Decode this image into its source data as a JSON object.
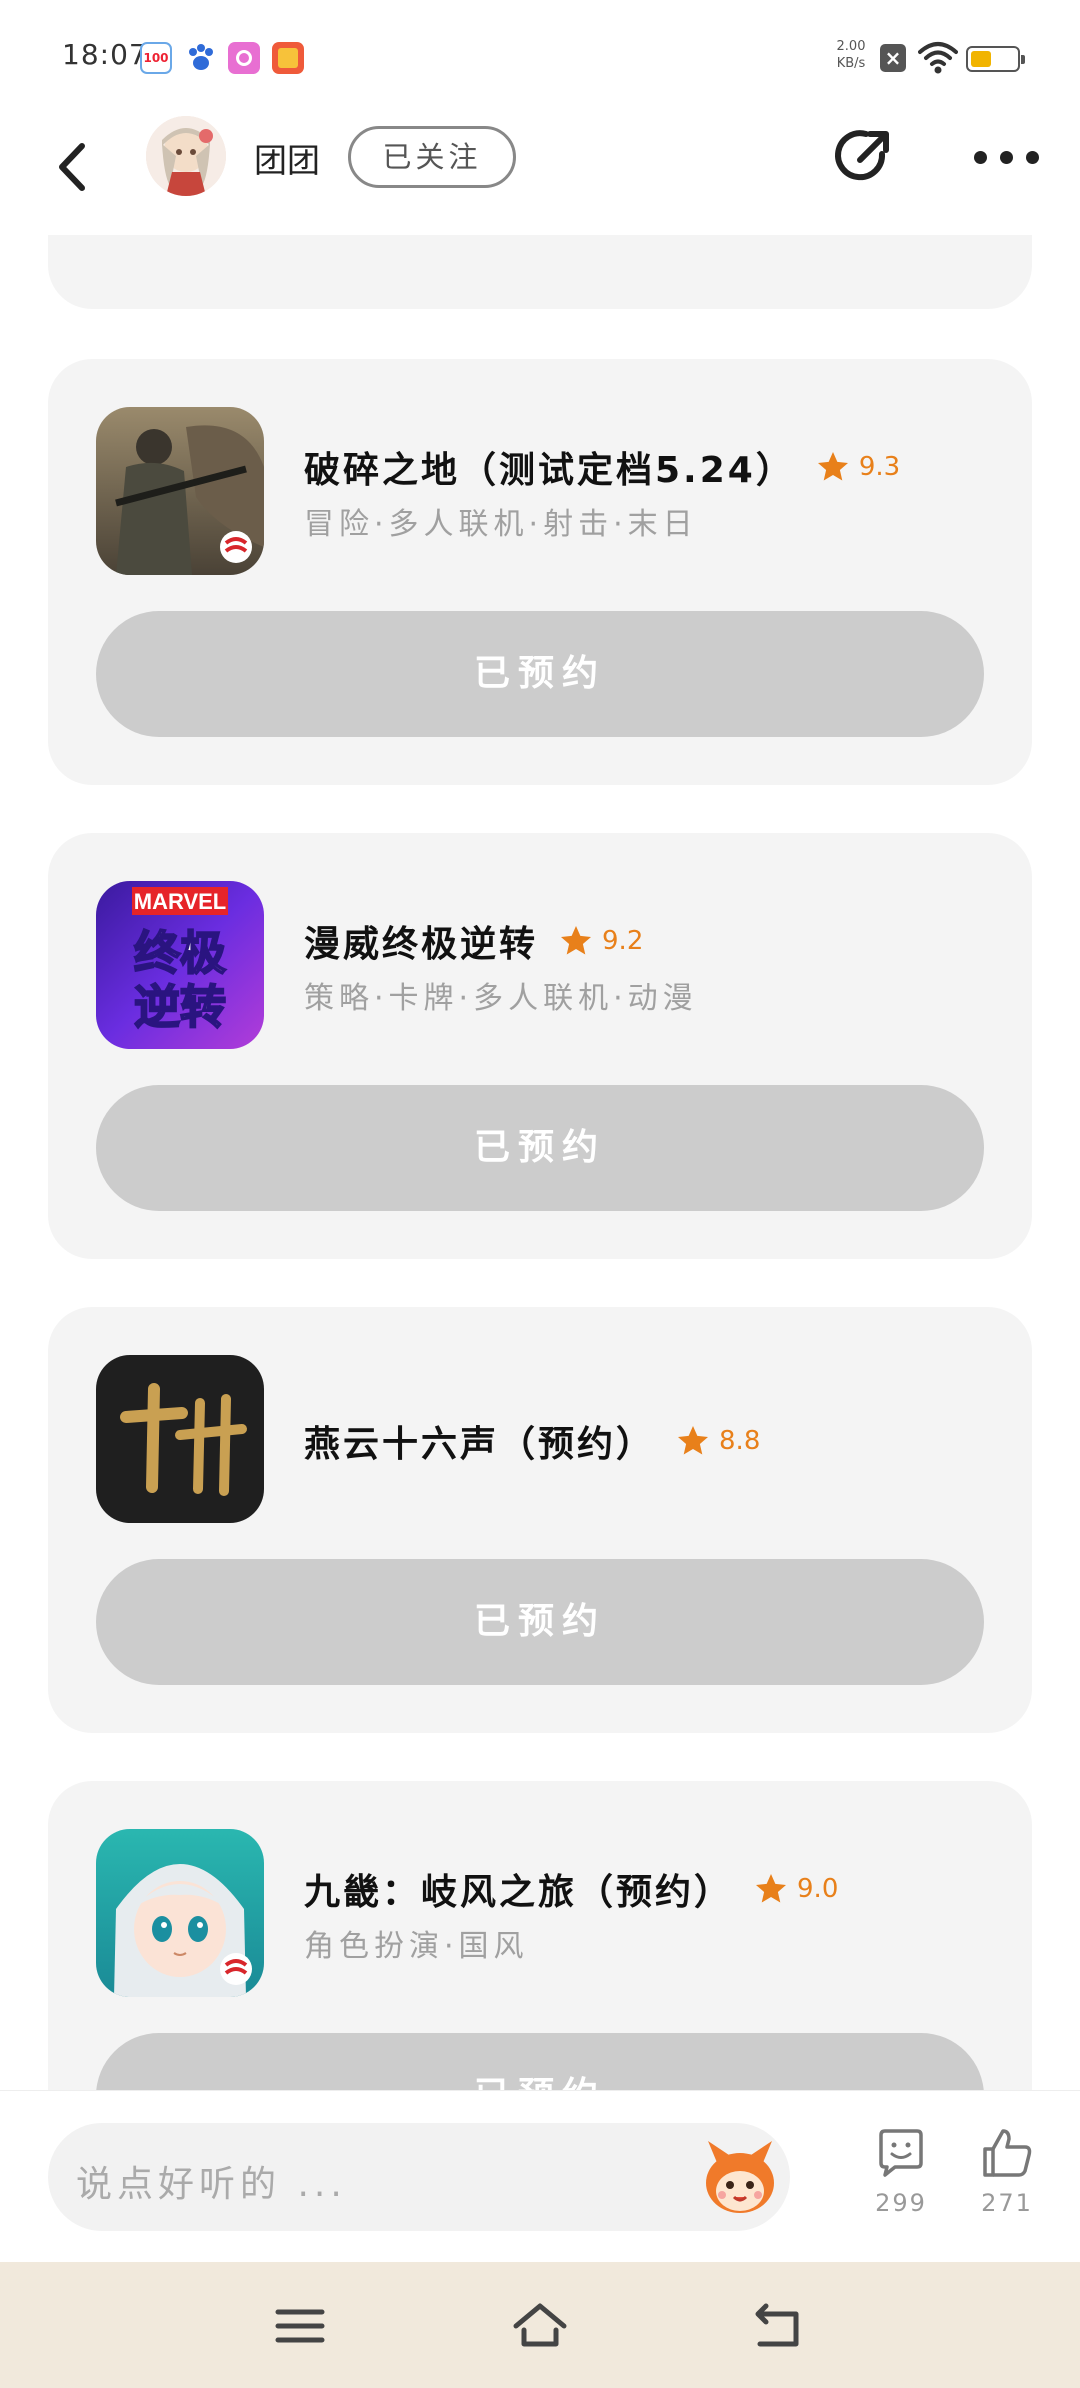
{
  "status_bar": {
    "time": "18:07",
    "net_speed_value": "2.00",
    "net_speed_unit": "KB/s",
    "battery_level": 0.45
  },
  "header": {
    "username": "团团",
    "follow_label": "已关注"
  },
  "games": [
    {
      "title": "破碎之地（测试定档5.24）",
      "rating": "9.3",
      "tags": "冒险·多人联机·射击·末日",
      "button": "已预约"
    },
    {
      "title": "漫威终极逆转",
      "rating": "9.2",
      "tags": "策略·卡牌·多人联机·动漫",
      "button": "已预约"
    },
    {
      "title": "燕云十六声（预约）",
      "rating": "8.8",
      "tags": "",
      "button": "已预约"
    },
    {
      "title": "九畿：岐风之旅（预约）",
      "rating": "9.0",
      "tags": "角色扮演·国风",
      "button": "已预约"
    }
  ],
  "icon_texts": {
    "marvel": "MARVEL",
    "marvel_line1": "终极",
    "marvel_line2": "逆转"
  },
  "comment_bar": {
    "placeholder": "说点好听的 ...",
    "comment_count": "299",
    "like_count": "271"
  },
  "colors": {
    "accent_rating": "#e8801a",
    "button_reserved": "#cccccc",
    "card_bg": "#f4f4f4",
    "navbar_bg": "#f1e9dc"
  },
  "icons": [
    "back-arrow-icon",
    "share-icon",
    "more-icon",
    "star-icon",
    "comment-icon",
    "thumbs-up-icon",
    "menu-icon",
    "home-icon",
    "back-nav-icon"
  ]
}
